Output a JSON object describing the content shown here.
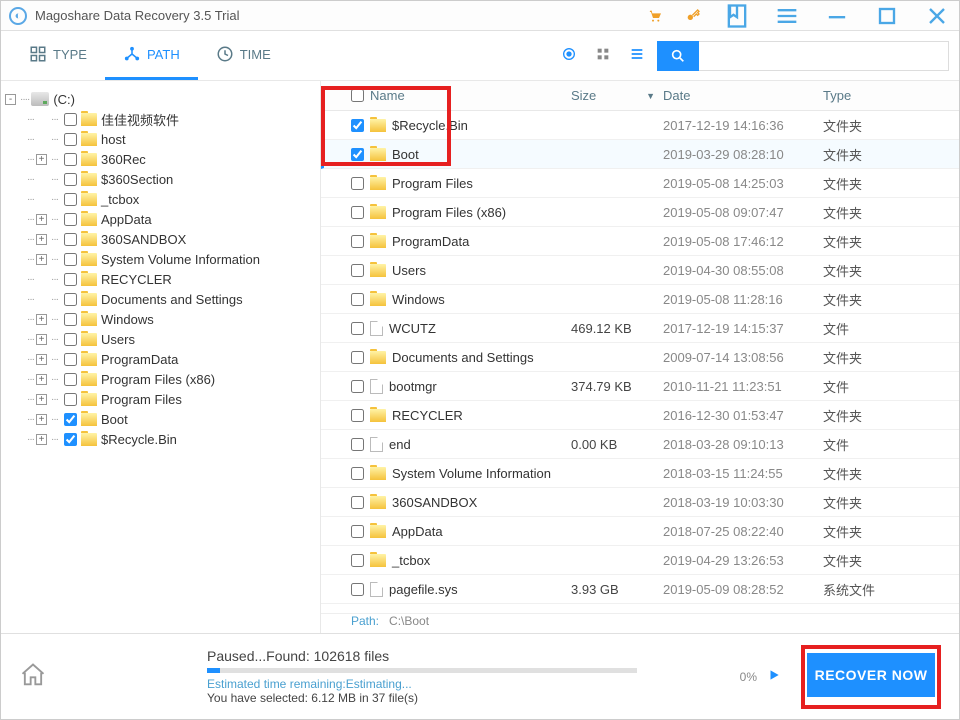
{
  "title": "Magoshare Data Recovery 3.5 Trial",
  "tabs": {
    "type": "TYPE",
    "path": "PATH",
    "time": "TIME"
  },
  "headers": {
    "name": "Name",
    "size": "Size",
    "date": "Date",
    "type": "Type"
  },
  "drive": "(C:)",
  "tree": [
    {
      "exp": "",
      "indent": 2,
      "chk": false,
      "name": "佳佳视频软件"
    },
    {
      "exp": "",
      "indent": 2,
      "chk": false,
      "name": "host"
    },
    {
      "exp": "+",
      "indent": 2,
      "chk": false,
      "name": "360Rec"
    },
    {
      "exp": "",
      "indent": 2,
      "chk": false,
      "name": "$360Section"
    },
    {
      "exp": "",
      "indent": 2,
      "chk": false,
      "name": "_tcbox"
    },
    {
      "exp": "+",
      "indent": 2,
      "chk": false,
      "name": "AppData"
    },
    {
      "exp": "+",
      "indent": 2,
      "chk": false,
      "name": "360SANDBOX"
    },
    {
      "exp": "+",
      "indent": 2,
      "chk": false,
      "name": "System Volume Information"
    },
    {
      "exp": "",
      "indent": 2,
      "chk": false,
      "name": "RECYCLER"
    },
    {
      "exp": "",
      "indent": 2,
      "chk": false,
      "name": "Documents and Settings"
    },
    {
      "exp": "+",
      "indent": 2,
      "chk": false,
      "name": "Windows"
    },
    {
      "exp": "+",
      "indent": 2,
      "chk": false,
      "name": "Users"
    },
    {
      "exp": "+",
      "indent": 2,
      "chk": false,
      "name": "ProgramData"
    },
    {
      "exp": "+",
      "indent": 2,
      "chk": false,
      "name": "Program Files (x86)"
    },
    {
      "exp": "+",
      "indent": 2,
      "chk": false,
      "name": "Program Files"
    },
    {
      "exp": "+",
      "indent": 2,
      "chk": true,
      "name": "Boot"
    },
    {
      "exp": "+",
      "indent": 2,
      "chk": true,
      "name": "$Recycle.Bin"
    }
  ],
  "files": [
    {
      "chk": true,
      "icon": "folder",
      "name": "$Recycle.Bin",
      "size": "",
      "date": "2017-12-19 14:16:36",
      "type": "文件夹",
      "sel": false
    },
    {
      "chk": true,
      "icon": "folder",
      "name": "Boot",
      "size": "",
      "date": "2019-03-29 08:28:10",
      "type": "文件夹",
      "sel": true
    },
    {
      "chk": false,
      "icon": "folder",
      "name": "Program Files",
      "size": "",
      "date": "2019-05-08 14:25:03",
      "type": "文件夹",
      "sel": false
    },
    {
      "chk": false,
      "icon": "folder",
      "name": "Program Files (x86)",
      "size": "",
      "date": "2019-05-08 09:07:47",
      "type": "文件夹",
      "sel": false
    },
    {
      "chk": false,
      "icon": "folder",
      "name": "ProgramData",
      "size": "",
      "date": "2019-05-08 17:46:12",
      "type": "文件夹",
      "sel": false
    },
    {
      "chk": false,
      "icon": "folder",
      "name": "Users",
      "size": "",
      "date": "2019-04-30 08:55:08",
      "type": "文件夹",
      "sel": false
    },
    {
      "chk": false,
      "icon": "folder",
      "name": "Windows",
      "size": "",
      "date": "2019-05-08 11:28:16",
      "type": "文件夹",
      "sel": false
    },
    {
      "chk": false,
      "icon": "file",
      "name": "WCUTZ",
      "size": "469.12 KB",
      "date": "2017-12-19 14:15:37",
      "type": "文件",
      "sel": false
    },
    {
      "chk": false,
      "icon": "folder",
      "name": "Documents and Settings",
      "size": "",
      "date": "2009-07-14 13:08:56",
      "type": "文件夹",
      "sel": false
    },
    {
      "chk": false,
      "icon": "file",
      "name": "bootmgr",
      "size": "374.79 KB",
      "date": "2010-11-21 11:23:51",
      "type": "文件",
      "sel": false
    },
    {
      "chk": false,
      "icon": "folder",
      "name": "RECYCLER",
      "size": "",
      "date": "2016-12-30 01:53:47",
      "type": "文件夹",
      "sel": false
    },
    {
      "chk": false,
      "icon": "file",
      "name": "end",
      "size": "0.00 KB",
      "date": "2018-03-28 09:10:13",
      "type": "文件",
      "sel": false
    },
    {
      "chk": false,
      "icon": "folder",
      "name": "System Volume Information",
      "size": "",
      "date": "2018-03-15 11:24:55",
      "type": "文件夹",
      "sel": false
    },
    {
      "chk": false,
      "icon": "folder",
      "name": "360SANDBOX",
      "size": "",
      "date": "2018-03-19 10:03:30",
      "type": "文件夹",
      "sel": false
    },
    {
      "chk": false,
      "icon": "folder",
      "name": "AppData",
      "size": "",
      "date": "2018-07-25 08:22:40",
      "type": "文件夹",
      "sel": false
    },
    {
      "chk": false,
      "icon": "folder",
      "name": "_tcbox",
      "size": "",
      "date": "2019-04-29 13:26:53",
      "type": "文件夹",
      "sel": false
    },
    {
      "chk": false,
      "icon": "file",
      "name": "pagefile.sys",
      "size": "3.93 GB",
      "date": "2019-05-09 08:28:52",
      "type": "系统文件",
      "sel": false
    }
  ],
  "pathline": {
    "label": "Path:",
    "value": "C:\\Boot"
  },
  "status": {
    "line1": "Paused...Found: 102618 files",
    "line2": "Estimated time remaining:Estimating...",
    "line3": "You have selected: 6.12 MB in 37 file(s)",
    "percent": "0%"
  },
  "recover_label": "RECOVER NOW"
}
